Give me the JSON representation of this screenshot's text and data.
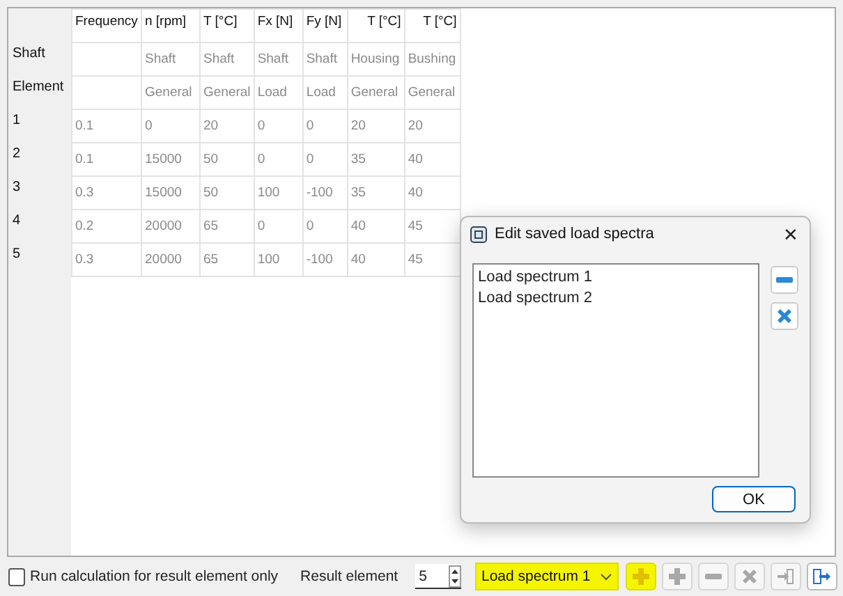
{
  "table": {
    "row_header_labels": [
      "Shaft",
      "Element"
    ],
    "columns": [
      {
        "name": "Frequency"
      },
      {
        "name": "n [rpm]",
        "target": "Shaft",
        "category": "General"
      },
      {
        "name": "T [°C]",
        "target": "Shaft",
        "category": "General"
      },
      {
        "name": "Fx [N]",
        "target": "Shaft",
        "category": "Load"
      },
      {
        "name": "Fy [N]",
        "target": "Shaft",
        "category": "Load"
      },
      {
        "name": "T [°C]",
        "target": "Housing",
        "category": "General"
      },
      {
        "name": "T [°C]",
        "target": "Bushing",
        "category": "General"
      }
    ],
    "rows": [
      {
        "label": "1",
        "cells": [
          "0.1",
          "0",
          "20",
          "0",
          "0",
          "20",
          "20"
        ]
      },
      {
        "label": "2",
        "cells": [
          "0.1",
          "15000",
          "50",
          "0",
          "0",
          "35",
          "40"
        ]
      },
      {
        "label": "3",
        "cells": [
          "0.3",
          "15000",
          "50",
          "100",
          "-100",
          "35",
          "40"
        ]
      },
      {
        "label": "4",
        "cells": [
          "0.2",
          "20000",
          "65",
          "0",
          "0",
          "40",
          "45"
        ]
      },
      {
        "label": "5",
        "cells": [
          "0.3",
          "20000",
          "65",
          "100",
          "-100",
          "40",
          "45"
        ]
      }
    ]
  },
  "dialog": {
    "title": "Edit saved load spectra",
    "close": "✕",
    "items": [
      {
        "label": "Load spectrum 1",
        "selected": false
      },
      {
        "label": "Load spectrum 2",
        "selected": false
      }
    ],
    "side_buttons": [
      {
        "kind": "minus"
      },
      {
        "kind": "delete"
      }
    ],
    "ok_button": "OK"
  },
  "bottom_bar": {
    "checkbox": {
      "label": "Run calculation for result element only",
      "checked": false
    },
    "result_element_label": "Result element",
    "result_element": "5",
    "spectrum_dropdown": {
      "value": "Load spectrum 1",
      "highlighted": true
    },
    "tools": [
      {
        "kind": "add",
        "disabled": false,
        "highlighted": true
      },
      {
        "kind": "add",
        "disabled": true,
        "highlighted": false
      },
      {
        "kind": "minus",
        "disabled": true,
        "highlighted": false
      },
      {
        "kind": "delete",
        "disabled": true,
        "highlighted": false
      },
      {
        "kind": "import",
        "disabled": true,
        "highlighted": false
      },
      {
        "kind": "export",
        "disabled": false,
        "highlighted": false
      }
    ]
  }
}
